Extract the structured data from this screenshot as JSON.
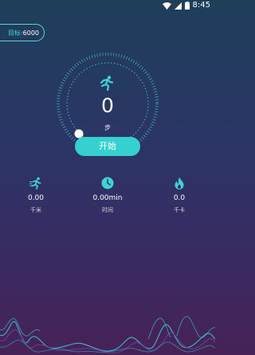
{
  "status_bar": {
    "time": "8:45",
    "icons": [
      "wifi-icon",
      "signal-icon",
      "battery-icon"
    ]
  },
  "goal": {
    "label": "目标:",
    "value": "6000"
  },
  "pedometer": {
    "steps": "0",
    "unit": "步",
    "icon": "runner-icon"
  },
  "start_button": {
    "label": "开始"
  },
  "stats": [
    {
      "icon": "running-icon",
      "value": "0.00",
      "label": "千米"
    },
    {
      "icon": "clock-icon",
      "value": "0.00min",
      "label": "时间"
    },
    {
      "icon": "flame-icon",
      "value": "0.0",
      "label": "千卡"
    }
  ],
  "colors": {
    "accent": "#36d0d0",
    "bg_top": "#1e3f5a",
    "bg_bottom": "#472256"
  }
}
